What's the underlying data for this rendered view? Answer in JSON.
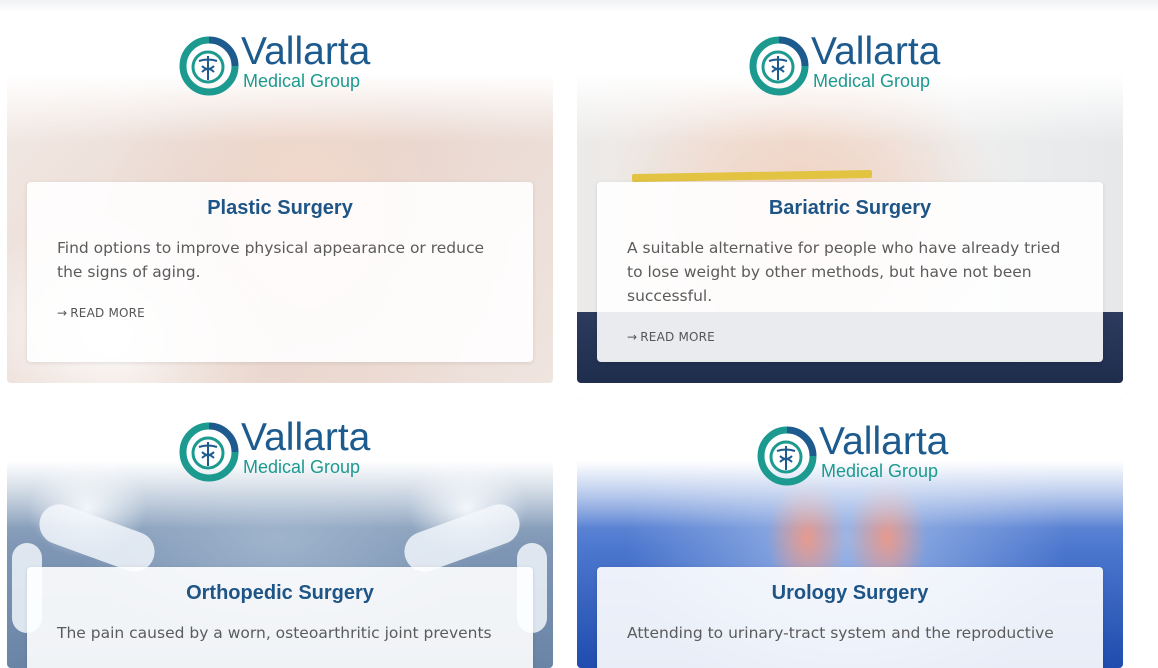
{
  "logo": {
    "title": "Vallarta",
    "subtitle": "Medical Group",
    "colors": {
      "navy": "#1d5a8e",
      "teal": "#1c9a8f"
    }
  },
  "cards": [
    {
      "title": "Plastic Surgery",
      "description": "Find options to improve physical appearance or reduce the signs of aging.",
      "read_more": "READ MORE",
      "arrow_icon": "right-arrow-icon"
    },
    {
      "title": "Bariatric Surgery",
      "description": "A suitable alternative for people who have already tried to lose weight by other methods, but have not been successful.",
      "read_more": "READ MORE",
      "arrow_icon": "right-arrow-icon"
    },
    {
      "title": "Orthopedic Surgery",
      "description": "The pain caused by a worn, osteoarthritic joint prevents"
    },
    {
      "title": "Urology Surgery",
      "description": "Attending to urinary-tract system and the reproductive"
    }
  ],
  "theme": {
    "heading_color": "#1e5586",
    "text_color": "#5b5b5b"
  }
}
